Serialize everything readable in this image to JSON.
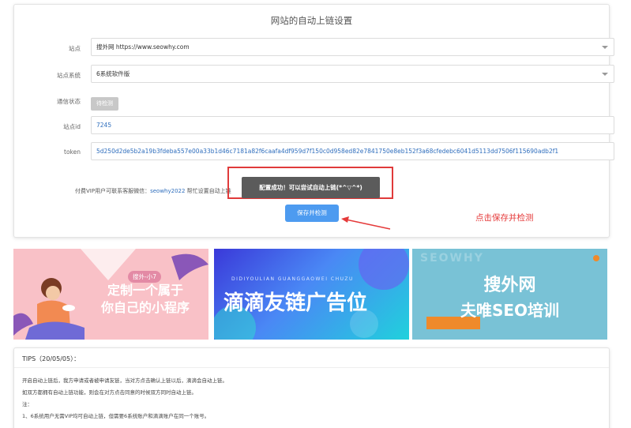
{
  "panel": {
    "title": "网站的自动上链设置",
    "site_label": "站点",
    "site_value": "搜外网 https://www.seowhy.com",
    "system_label": "站点系统",
    "system_value": "6系统软件版",
    "status_label": "通信状态",
    "status_value": "待检测",
    "siteid_label": "站点id",
    "siteid_value": "7245",
    "token_label": "token",
    "token_value": "5d250d2de5b2a19b3fdeba557e00a33b1d46c7181a82f6caafa4df959d7f150c0d958ed82e7841750e8eb152f3a68cfedebc6041d5113dd7506f115690adb2f1",
    "help_prefix": "付费VIP用户可联系客服微信：",
    "help_wechat": "seowhy2022",
    "help_suffix": " 帮忙设置自动上链",
    "toast": "配置成功！可以尝试自动上链(*^▽^*)",
    "save_button": "保存并检测",
    "annotation": "点击保存并检测"
  },
  "banners": {
    "b1_tag": "搜外-小7",
    "b1_line1": "定制一个属于",
    "b1_line2": "你自己的小程序",
    "b2_small": "DIDIYOULIAN GUANGGAOWEI CHUZU",
    "b2_text": "滴滴友链广告位",
    "b3_watermark": "SEOWHY",
    "b3_title": "搜外网",
    "b3_sub": "夫唯SEO培训"
  },
  "tips": {
    "title": "TIPS（20/05/05）：",
    "line1": "开启自动上链后，我方申请或者被申请友链，当对方点击确认上链以后，滴滴会自动上链。",
    "line2": "如双方都拥有自动上链功能，则会在对方点击同意的时候双方同时自动上链。",
    "line3": "注：",
    "line4": "1、6系统用户无需VIP均可自动上链，但需要6系统账户和滴滴账户在同一个账号。"
  },
  "colors": {
    "accent": "#4d9bf0",
    "annotation": "#e53a3a",
    "toast_bg": "#5b5b5b"
  }
}
